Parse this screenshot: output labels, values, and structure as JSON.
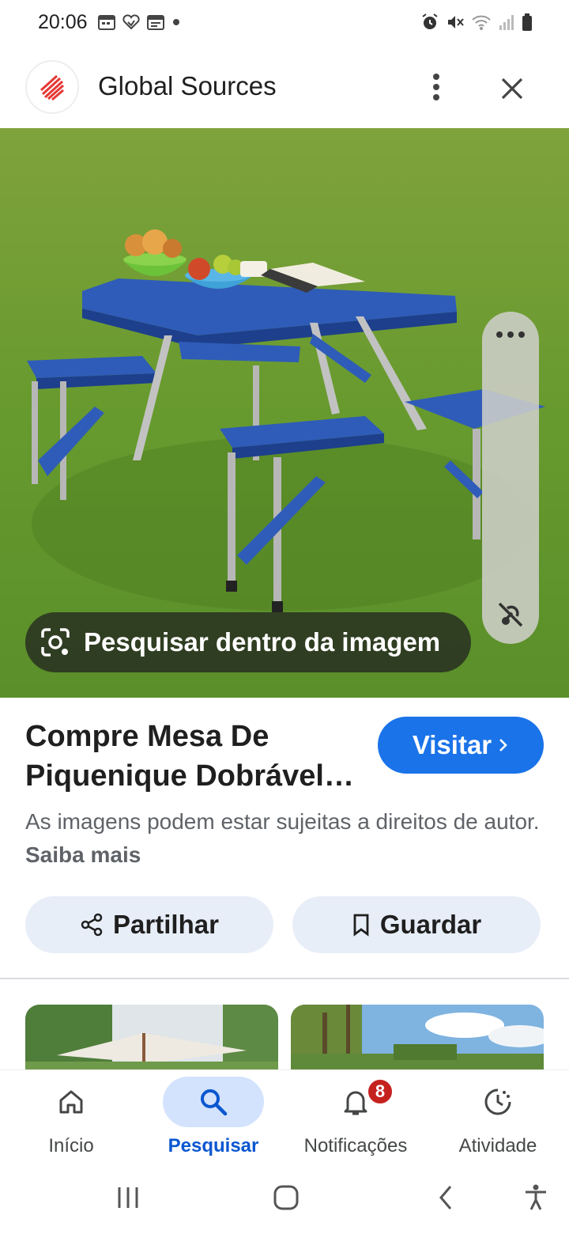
{
  "status_bar": {
    "time": "20:06"
  },
  "header": {
    "title": "Global Sources",
    "brand_color": "#e53935"
  },
  "image_overlay": {
    "search_label": "Pesquisar dentro da imagem"
  },
  "result": {
    "title": "Compre Mesa De Piquenique Dobrável…",
    "visit_label": "Visitar",
    "copyright_text": "As imagens podem estar sujeitas a direitos de autor.",
    "copyright_link": "Saiba mais",
    "share_label": "Partilhar",
    "save_label": "Guardar"
  },
  "bottom_nav": {
    "items": [
      {
        "label": "Início",
        "icon": "home-icon"
      },
      {
        "label": "Pesquisar",
        "icon": "search-icon",
        "active": true
      },
      {
        "label": "Notificações",
        "icon": "bell-icon",
        "badge": "8"
      },
      {
        "label": "Atividade",
        "icon": "activity-icon"
      }
    ]
  },
  "colors": {
    "accent": "#1a73e8",
    "active_nav": "#0b57d0",
    "badge": "#c5221f",
    "button_bg": "#e8eef8"
  }
}
